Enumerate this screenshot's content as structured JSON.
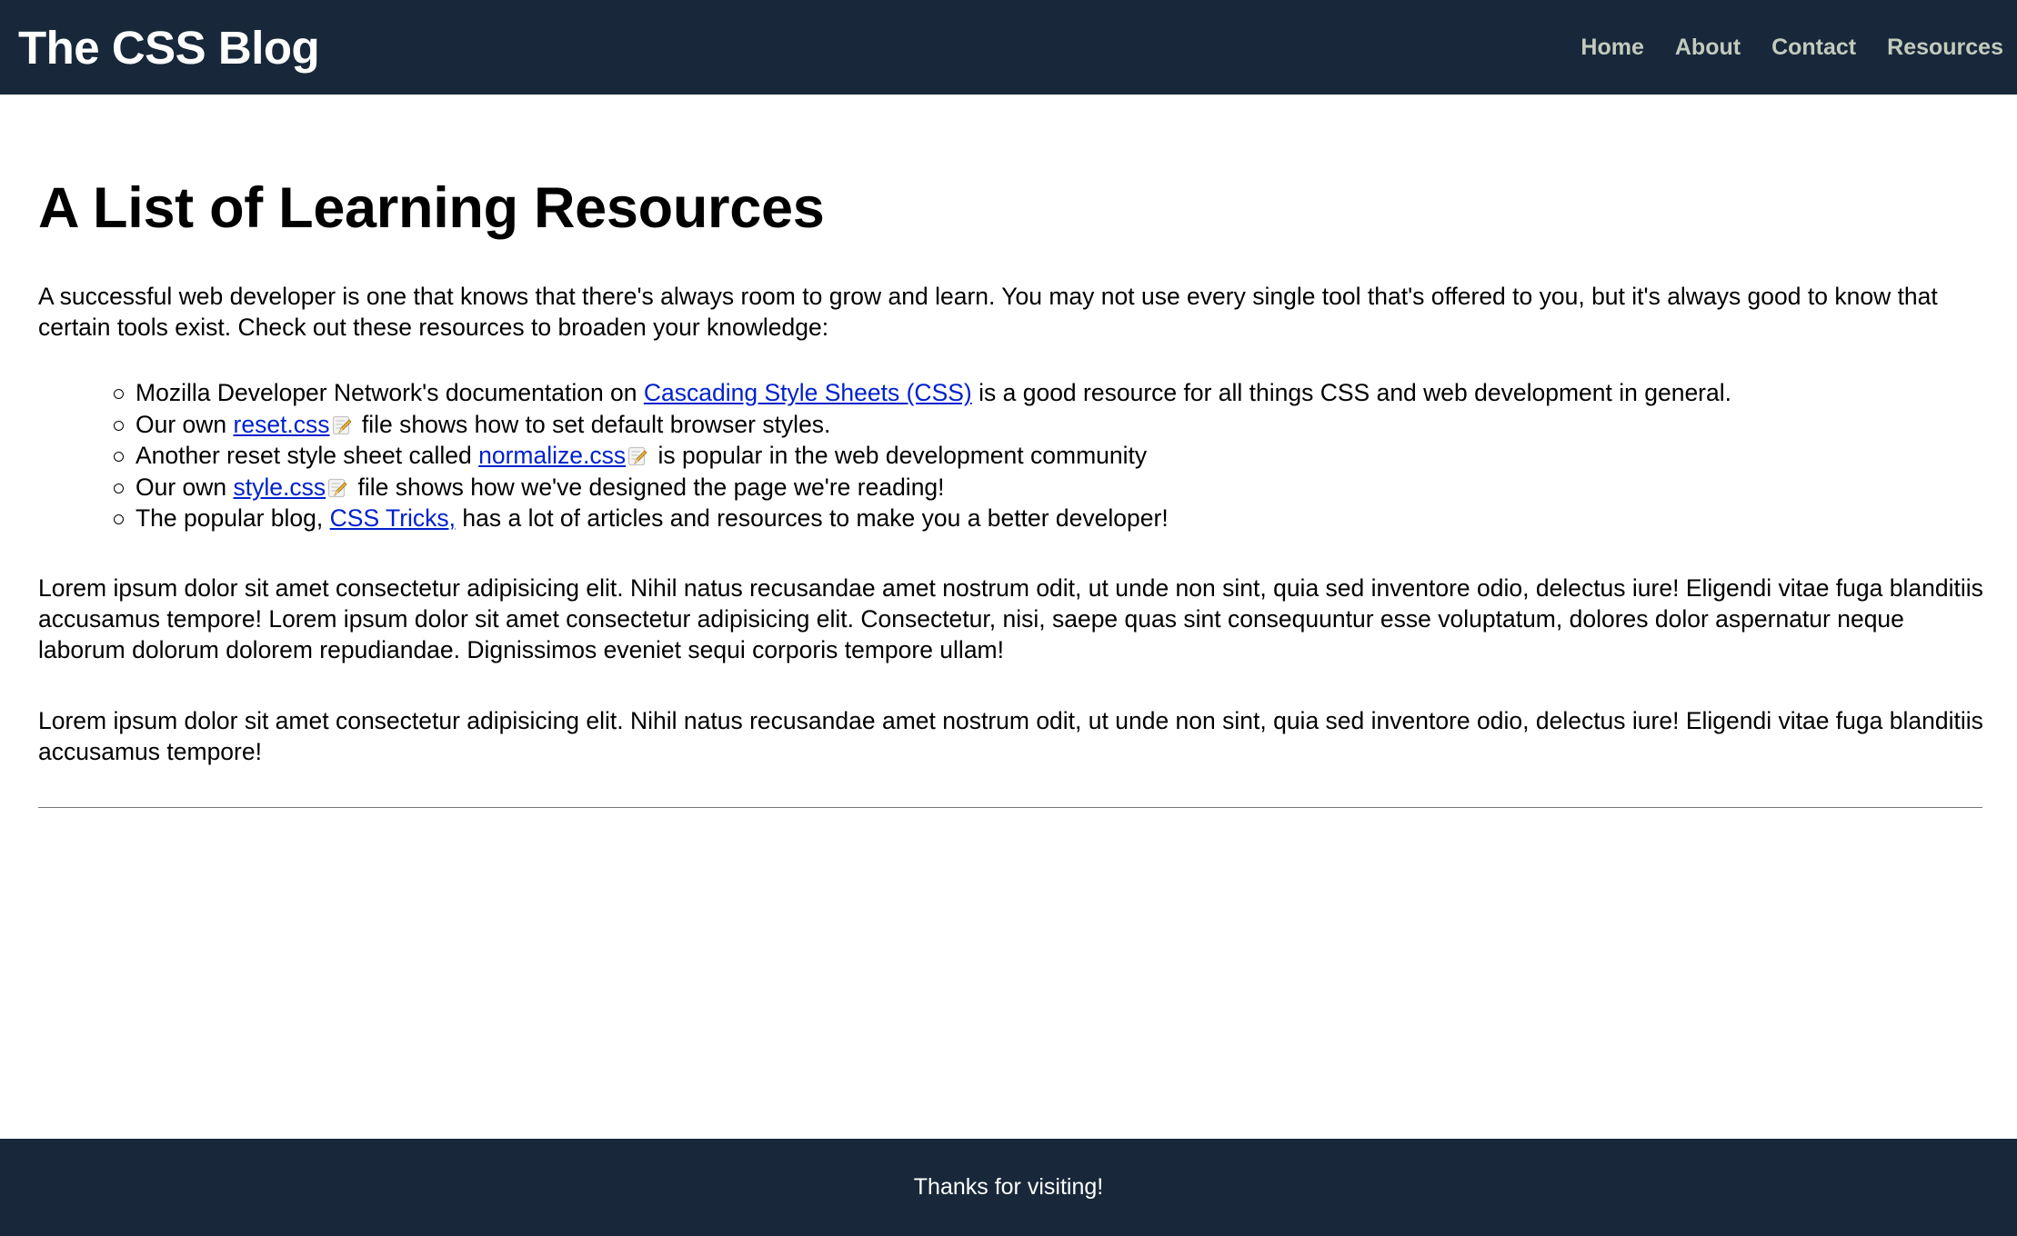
{
  "header": {
    "title": "The CSS Blog",
    "nav": [
      "Home",
      "About",
      "Contact",
      "Resources"
    ]
  },
  "main": {
    "title": "A List of Learning Resources",
    "intro": "A successful web developer is one that knows that there's always room to grow and learn. You may not use every single tool that's offered to you, but it's always good to know that certain tools exist. Check out these resources to broaden your knowledge:",
    "resources": [
      {
        "before": "Mozilla Developer Network's documentation on ",
        "link": "Cascading Style Sheets (CSS)",
        "after": " is a good resource for all things CSS and web development in general."
      },
      {
        "before": "Our own ",
        "link": "reset.css",
        "after": " file shows how to set default browser styles."
      },
      {
        "before": "Another reset style sheet called ",
        "link": "normalize.css",
        "after": " is popular in the web development community"
      },
      {
        "before": "Our own ",
        "link": "style.css",
        "after": " file shows how we've designed the page we're reading!"
      },
      {
        "before": "The popular blog, ",
        "link": "CSS Tricks,",
        "after": " has a lot of articles and resources to make you a better developer!"
      }
    ],
    "paragraphs": [
      "Lorem ipsum dolor sit amet consectetur adipisicing elit. Nihil natus recusandae amet nostrum odit, ut unde non sint, quia sed inventore odio, delectus iure! Eligendi vitae fuga blanditiis accusamus tempore! Lorem ipsum dolor sit amet consectetur adipisicing elit. Consectetur, nisi, saepe quas sint consequuntur esse voluptatum, dolores dolor aspernatur neque laborum dolorum dolorem repudiandae. Dignissimos eveniet sequi corporis tempore ullam!",
      "Lorem ipsum dolor sit amet consectetur adipisicing elit. Nihil natus recusandae amet nostrum odit, ut unde non sint, quia sed inventore odio, delectus iure! Eligendi vitae fuga blanditiis accusamus tempore!"
    ]
  },
  "footer": {
    "text": "Thanks for visiting!"
  },
  "colors": {
    "header_bg": "#18283a",
    "nav_link": "#c2cbbd",
    "link": "#0021cc"
  },
  "icons": {
    "file_link": "file-edit-icon"
  }
}
